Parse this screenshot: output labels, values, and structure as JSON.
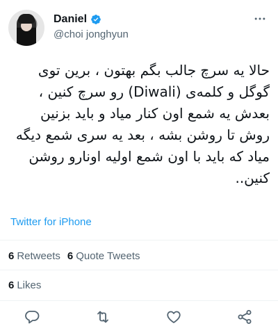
{
  "author": {
    "name": "Daniel",
    "handle": "@choi jonghyun",
    "verified": true
  },
  "tweet": {
    "text": "حالا یه سرچ جالب بگم بهتون ، برین توی گوگل و کلمه‌ی (Diwali) رو سرچ کنین ، بعدش یه شمع اون کنار میاد و باید بزنین روش تا روشن بشه ، بعد یه سری شمع دیگه میاد که باید با اون شمع اولیه اونارو روشن کنین..",
    "source": "Twitter for iPhone"
  },
  "stats": {
    "retweets_count": "6",
    "retweets_label": "Retweets",
    "quote_count": "6",
    "quote_label": "Quote Tweets",
    "likes_count": "6",
    "likes_label": "Likes"
  },
  "actions": {
    "reply": "reply-icon",
    "retweet": "retweet-icon",
    "like": "heart-icon",
    "share": "share-icon"
  },
  "colors": {
    "accent": "#1d9bf0",
    "secondary_text": "#536471",
    "divider": "#eff3f4"
  }
}
